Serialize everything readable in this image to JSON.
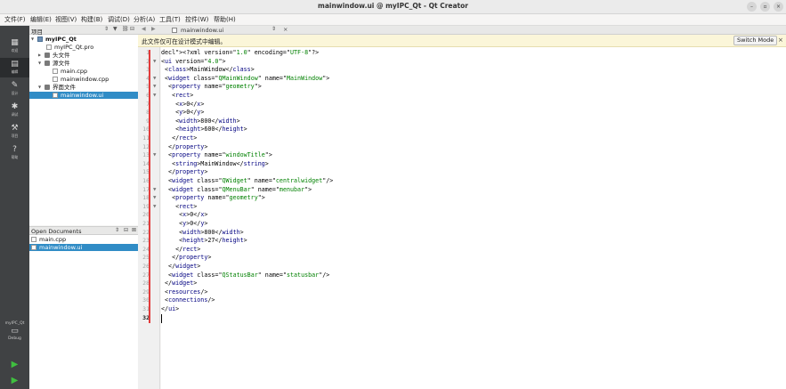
{
  "window": {
    "title": "mainwindow.ui @ myIPC_Qt - Qt Creator",
    "min_glyph": "–",
    "max_glyph": "▫",
    "close_glyph": "×"
  },
  "menu": [
    "文件(F)",
    "编辑(E)",
    "视图(V)",
    "构建(B)",
    "调试(D)",
    "分析(A)",
    "工具(T)",
    "控件(W)",
    "帮助(H)"
  ],
  "modes": [
    {
      "label": "欢迎",
      "icon": "grid-icon"
    },
    {
      "label": "编辑",
      "icon": "edit-icon"
    },
    {
      "label": "设计",
      "icon": "pencil-icon"
    },
    {
      "label": "调试",
      "icon": "bug-icon"
    },
    {
      "label": "项目",
      "icon": "wrench-icon"
    },
    {
      "label": "帮助",
      "icon": "help-icon"
    }
  ],
  "kit": {
    "project": "myIPC_Qt",
    "config": "Debug"
  },
  "project_pane": {
    "title": "项目",
    "tree": [
      {
        "label": "myIPC_Qt",
        "depth": 0,
        "type": "project",
        "expanded": true
      },
      {
        "label": "myIPC_Qt.pro",
        "depth": 1,
        "type": "file"
      },
      {
        "label": "头文件",
        "depth": 1,
        "type": "folder",
        "expanded": false
      },
      {
        "label": "源文件",
        "depth": 1,
        "type": "folder",
        "expanded": true
      },
      {
        "label": "main.cpp",
        "depth": 2,
        "type": "file"
      },
      {
        "label": "mainwindow.cpp",
        "depth": 2,
        "type": "file"
      },
      {
        "label": "界面文件",
        "depth": 1,
        "type": "folder",
        "expanded": true
      },
      {
        "label": "mainwindow.ui",
        "depth": 2,
        "type": "file",
        "selected": true
      }
    ]
  },
  "open_documents": {
    "title": "Open Documents",
    "items": [
      {
        "label": "main.cpp"
      },
      {
        "label": "mainwindow.ui",
        "selected": true
      }
    ]
  },
  "editor": {
    "tab_file": "mainwindow.ui",
    "info_message": "此文件仅可在设计模式中编辑。",
    "switch_mode_label": "Switch Mode",
    "line_numbers": [
      "1",
      "2",
      "3",
      "4",
      "5",
      "6",
      "7",
      "8",
      "9",
      "10",
      "11",
      "12",
      "13",
      "14",
      "15",
      "16",
      "17",
      "18",
      "19",
      "20",
      "21",
      "22",
      "23",
      "24",
      "25",
      "26",
      "27",
      "28",
      "29",
      "30",
      "31",
      "32"
    ],
    "fold_lines": [
      2,
      4,
      5,
      6,
      13,
      17,
      18,
      19
    ],
    "current_line": 32,
    "code_lines": [
      "<?xml version=\"1.0\" encoding=\"UTF-8\"?>",
      "<ui version=\"4.0\">",
      " <class>MainWindow</class>",
      " <widget class=\"QMainWindow\" name=\"MainWindow\">",
      "  <property name=\"geometry\">",
      "   <rect>",
      "    <x>0</x>",
      "    <y>0</y>",
      "    <width>800</width>",
      "    <height>600</height>",
      "   </rect>",
      "  </property>",
      "  <property name=\"windowTitle\">",
      "   <string>MainWindow</string>",
      "  </property>",
      "  <widget class=\"QWidget\" name=\"centralwidget\"/>",
      "  <widget class=\"QMenuBar\" name=\"menubar\">",
      "   <property name=\"geometry\">",
      "    <rect>",
      "     <x>0</x>",
      "     <y>0</y>",
      "     <width>800</width>",
      "     <height>27</height>",
      "    </rect>",
      "   </property>",
      "  </widget>",
      "  <widget class=\"QStatusBar\" name=\"statusbar\"/>",
      " </widget>",
      " <resources/>",
      " <connections/>",
      "</ui>",
      ""
    ]
  },
  "colors": {
    "tag": "#000080",
    "value": "#008000",
    "selection": "#308cc6",
    "modebar": "#404244",
    "fold_marker": "#e23b3b"
  }
}
